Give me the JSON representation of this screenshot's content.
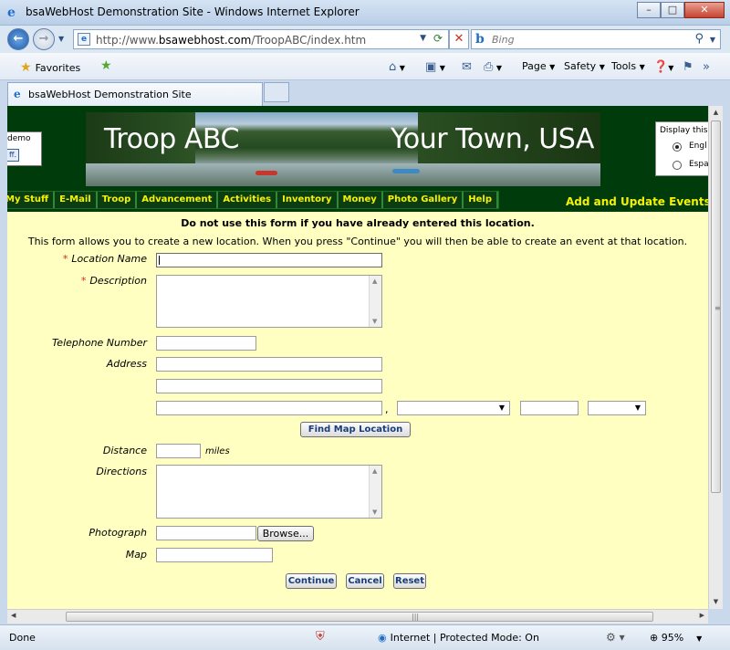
{
  "window": {
    "title": "bsaWebHost Demonstration Site - Windows Internet Explorer",
    "minimize": "–",
    "maximize": "□",
    "close": "✕"
  },
  "address_bar": {
    "url_prefix": "http://www.",
    "url_domain": "bsawebhost.com",
    "url_path": "/TroopABC/index.htm",
    "search_placeholder": "Bing"
  },
  "favorites_bar": {
    "favorites_label": "Favorites",
    "commands": [
      "Page",
      "Safety",
      "Tools"
    ]
  },
  "tabs": [
    {
      "label": "bsaWebHost Demonstration Site",
      "active": true
    }
  ],
  "page": {
    "side_widget": {
      "text": "demo",
      "button": "ff."
    },
    "banner": {
      "left_title": "Troop ABC",
      "right_title": "Your Town, USA"
    },
    "language_box": {
      "title": "Display this",
      "options": [
        {
          "label": "Engl",
          "selected": true
        },
        {
          "label": "Espa",
          "selected": false
        }
      ]
    },
    "nav": [
      "My Stuff",
      "E-Mail",
      "Troop",
      "Advancement",
      "Activities",
      "Inventory",
      "Money",
      "Photo Gallery",
      "Help"
    ],
    "page_title": "Add and Update Events",
    "warning": "Do not use this form if you have already entered this location.",
    "intro": "This form allows you to create a new location. When you press \"Continue\" you will then be able to create an event at that location.",
    "form": {
      "location_name_label": "Location Name",
      "description_label": "Description",
      "telephone_label": "Telephone Number",
      "address_label": "Address",
      "find_map_button": "Find Map Location",
      "distance_label": "Distance",
      "distance_unit": "miles",
      "directions_label": "Directions",
      "photograph_label": "Photograph",
      "browse_button": "Browse...",
      "map_label": "Map",
      "continue_button": "Continue",
      "cancel_button": "Cancel",
      "reset_button": "Reset",
      "required_marker": "*"
    }
  },
  "status_bar": {
    "status": "Done",
    "zone": "Internet | Protected Mode: On",
    "zoom": "95%"
  }
}
